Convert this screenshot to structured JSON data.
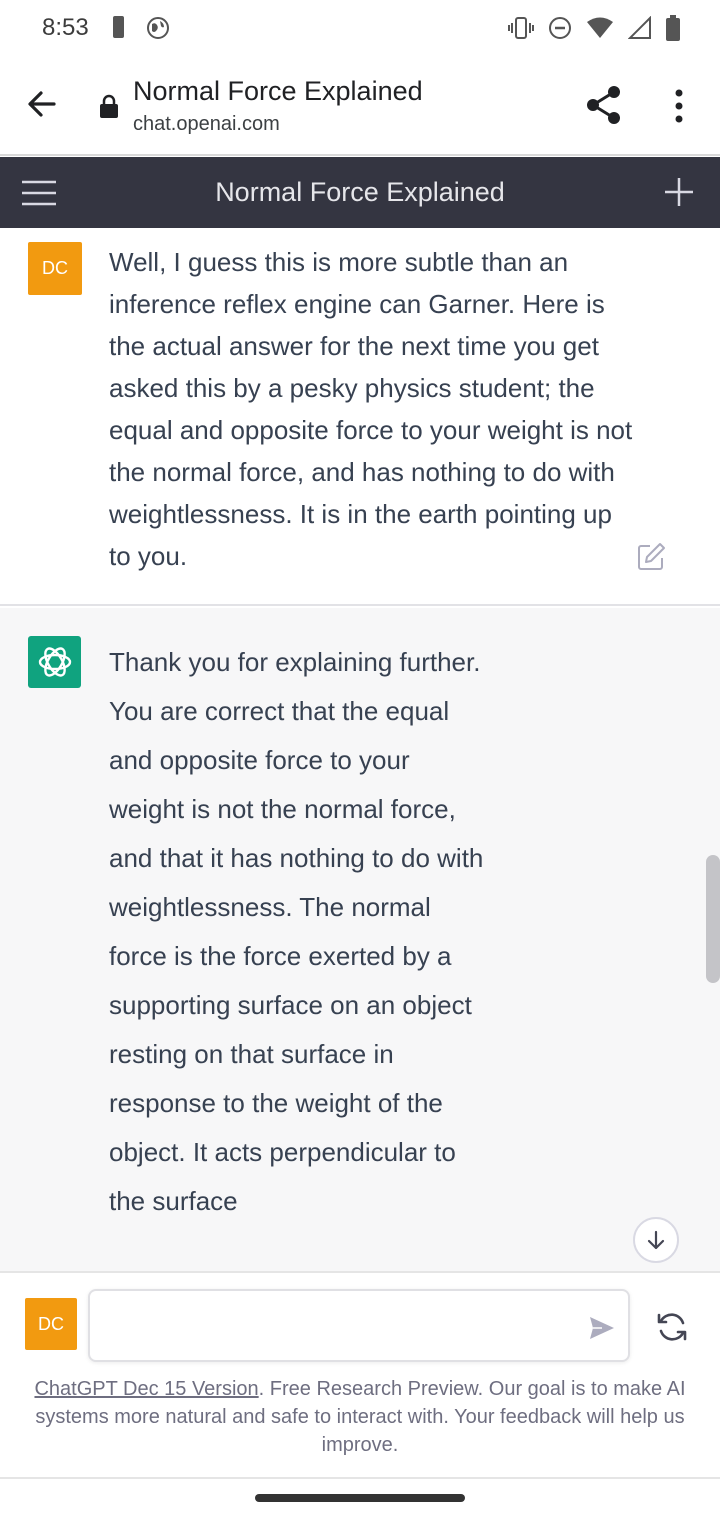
{
  "status_bar": {
    "time": "8:53",
    "icons": [
      "battery-saver-icon",
      "vpn-globe-icon",
      "vibrate-icon",
      "do-not-disturb-icon",
      "wifi-icon",
      "signal-icon",
      "battery-icon"
    ]
  },
  "browser": {
    "page_title": "Normal Force Explained",
    "host": "chat.openai.com"
  },
  "chat_header": {
    "title": "Normal Force Explained"
  },
  "messages": [
    {
      "role": "user",
      "avatar": "DC",
      "text": "Well, I guess this is more subtle than an inference reflex engine can Garner. Here is the actual answer for the next time you get asked this by a pesky physics student; the equal and opposite force to your weight is not the normal force, and has nothing to do with weightlessness. It is in the earth pointing up to you."
    },
    {
      "role": "assistant",
      "text": "Thank you for explaining further. You are correct that the equal and opposite force to your weight is not the normal force, and that it has nothing to do with weightlessness. The normal force is the force exerted by a supporting surface on an object resting on that surface in response to the weight of the object. It acts perpendicular to the surface"
    }
  ],
  "composer": {
    "avatar": "DC",
    "value": "",
    "placeholder": ""
  },
  "footer": {
    "link_text": "ChatGPT Dec 15 Version",
    "text": ". Free Research Preview. Our goal is to make AI systems more natural and safe to interact with. Your feedback will help us improve."
  },
  "colors": {
    "header_bg": "#343541",
    "user_avatar": "#f29a10",
    "assistant_avatar": "#10a37f",
    "assistant_bg": "#f7f7f8"
  }
}
